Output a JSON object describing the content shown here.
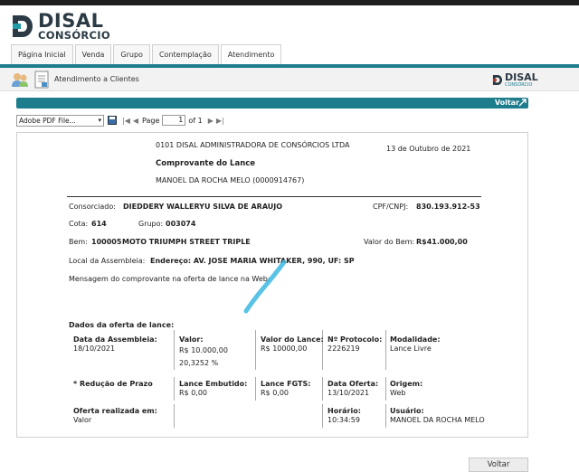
{
  "brand": {
    "name": "DISAL",
    "sub": "CONSÓRCIO",
    "small_name": "DISAL",
    "small_sub": "CONSÓRCIO"
  },
  "tabs": [
    {
      "label": "Página Inicial"
    },
    {
      "label": "Venda"
    },
    {
      "label": "Grupo"
    },
    {
      "label": "Contemplação"
    },
    {
      "label": "Atendimento"
    }
  ],
  "toolbar": {
    "label": "Atendimento a Clientes"
  },
  "voltar_top": "Voltar",
  "pdf": {
    "select_value": "Adobe PDF File...",
    "page_label": "Page",
    "page_value": "1",
    "of_label": "of 1"
  },
  "report": {
    "company": "0101 DISAL ADMINISTRADORA DE CONSÓRCIOS LTDA",
    "date": "13 de Outubro de 2021",
    "title": "Comprovante do Lance",
    "user_line": "MANOEL DA ROCHA MELO (0000914767)",
    "consorciado_label": "Consorciado:",
    "consorciado_value": "DIEDDERY WALLERYU SILVA DE ARAUJO",
    "cpf_label": "CPF/CNPJ:",
    "cpf_value": "830.193.912-53",
    "cota_label": "Cota:",
    "cota_value": "614",
    "grupo_label": "Grupo:",
    "grupo_value": "003074",
    "bem_label": "Bem:",
    "bem_code": "100005",
    "bem_value": "MOTO TRIUMPH STREET TRIPLE",
    "valor_bem_label": "Valor do Bem:",
    "valor_bem_value": "R$41.000,00",
    "local_label": "Local da Assembleia:",
    "local_value": "Endereço: AV. JOSE MARIA WHITAKER, 990, UF: SP",
    "mensagem": "Mensagem do comprovante na oferta de lance na Web:",
    "dados_title": "Dados da oferta de lance:",
    "data_assembleia_label": "Data da Assembleia:",
    "data_assembleia_value": "18/10/2021",
    "valor_label": "Valor:",
    "valor_value": "R$ 10.000,00",
    "valor_pct": "20,3252 %",
    "valor_lance_label": "Valor do Lance:",
    "valor_lance_value": "R$ 10000,00",
    "protocolo_label": "Nº Protocolo:",
    "protocolo_value": "2226219",
    "modalidade_label": "Modalidade:",
    "modalidade_value": "Lance Livre",
    "reducao_label": "* Redução de Prazo",
    "embutido_label": "Lance Embutido:",
    "embutido_value": "R$ 0,00",
    "fgts_label": "Lance FGTS:",
    "fgts_value": "R$ 0,00",
    "data_oferta_label": "Data Oferta:",
    "data_oferta_value": "13/10/2021",
    "origem_label": "Origem:",
    "origem_value": "Web",
    "oferta_realizada_label": "Oferta realizada em:",
    "oferta_realizada_value": "Valor",
    "horario_label": "Horário:",
    "horario_value": "10:34:59",
    "usuario_label": "Usuário:",
    "usuario_value": "MANOEL DA ROCHA MELO"
  },
  "voltar_bottom": "Voltar",
  "colors": {
    "accent": "#1e7d8c",
    "dark": "#2b3a44"
  }
}
